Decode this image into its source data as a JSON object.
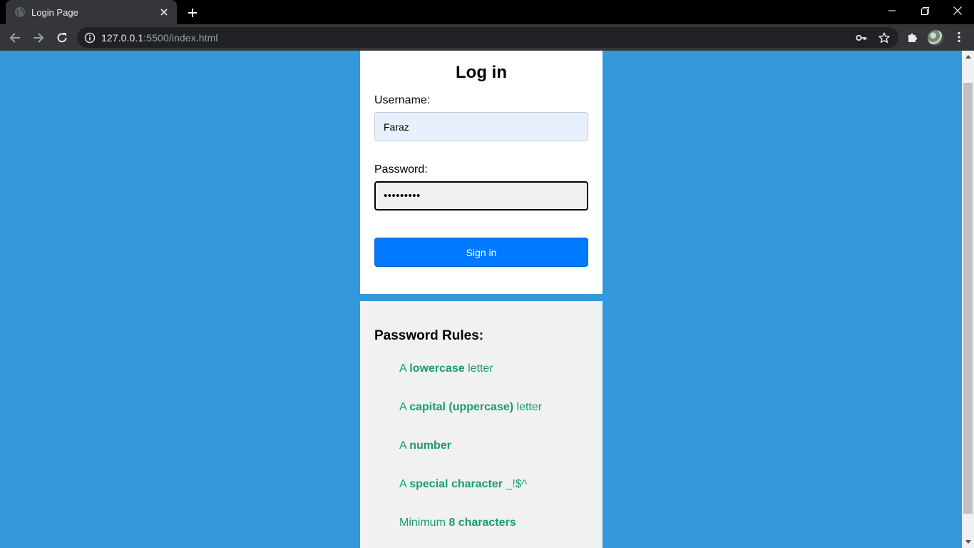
{
  "browser": {
    "tab_title": "Login Page",
    "url_host": "127.0.0.1",
    "url_path": ":5500/index.html"
  },
  "login": {
    "title": "Log in",
    "username_label": "Username:",
    "username_value": "Faraz",
    "password_label": "Password:",
    "password_value": "password1",
    "submit_label": "Sign in"
  },
  "rules": {
    "title": "Password Rules:",
    "items": [
      {
        "prefix": "A ",
        "bold": "lowercase",
        "suffix": " letter"
      },
      {
        "prefix": "A ",
        "bold": "capital (uppercase)",
        "suffix": " letter"
      },
      {
        "prefix": "A ",
        "bold": "number",
        "suffix": ""
      },
      {
        "prefix": "A ",
        "bold": "special character",
        "suffix": " _!$^"
      },
      {
        "prefix": "Minimum ",
        "bold": "8 characters",
        "suffix": ""
      }
    ]
  },
  "colors": {
    "page_background": "#3498db",
    "rule_valid": "#1a9e6a",
    "button": "#007bff"
  },
  "icons": {
    "tab": "globe-icon",
    "close": "close-icon",
    "new_tab": "plus-icon",
    "back": "arrow-left-icon",
    "forward": "arrow-right-icon",
    "reload": "reload-icon",
    "site_info": "info-icon",
    "password_key": "key-icon",
    "bookmark": "star-icon",
    "extensions": "puzzle-icon",
    "menu": "kebab-menu-icon"
  }
}
